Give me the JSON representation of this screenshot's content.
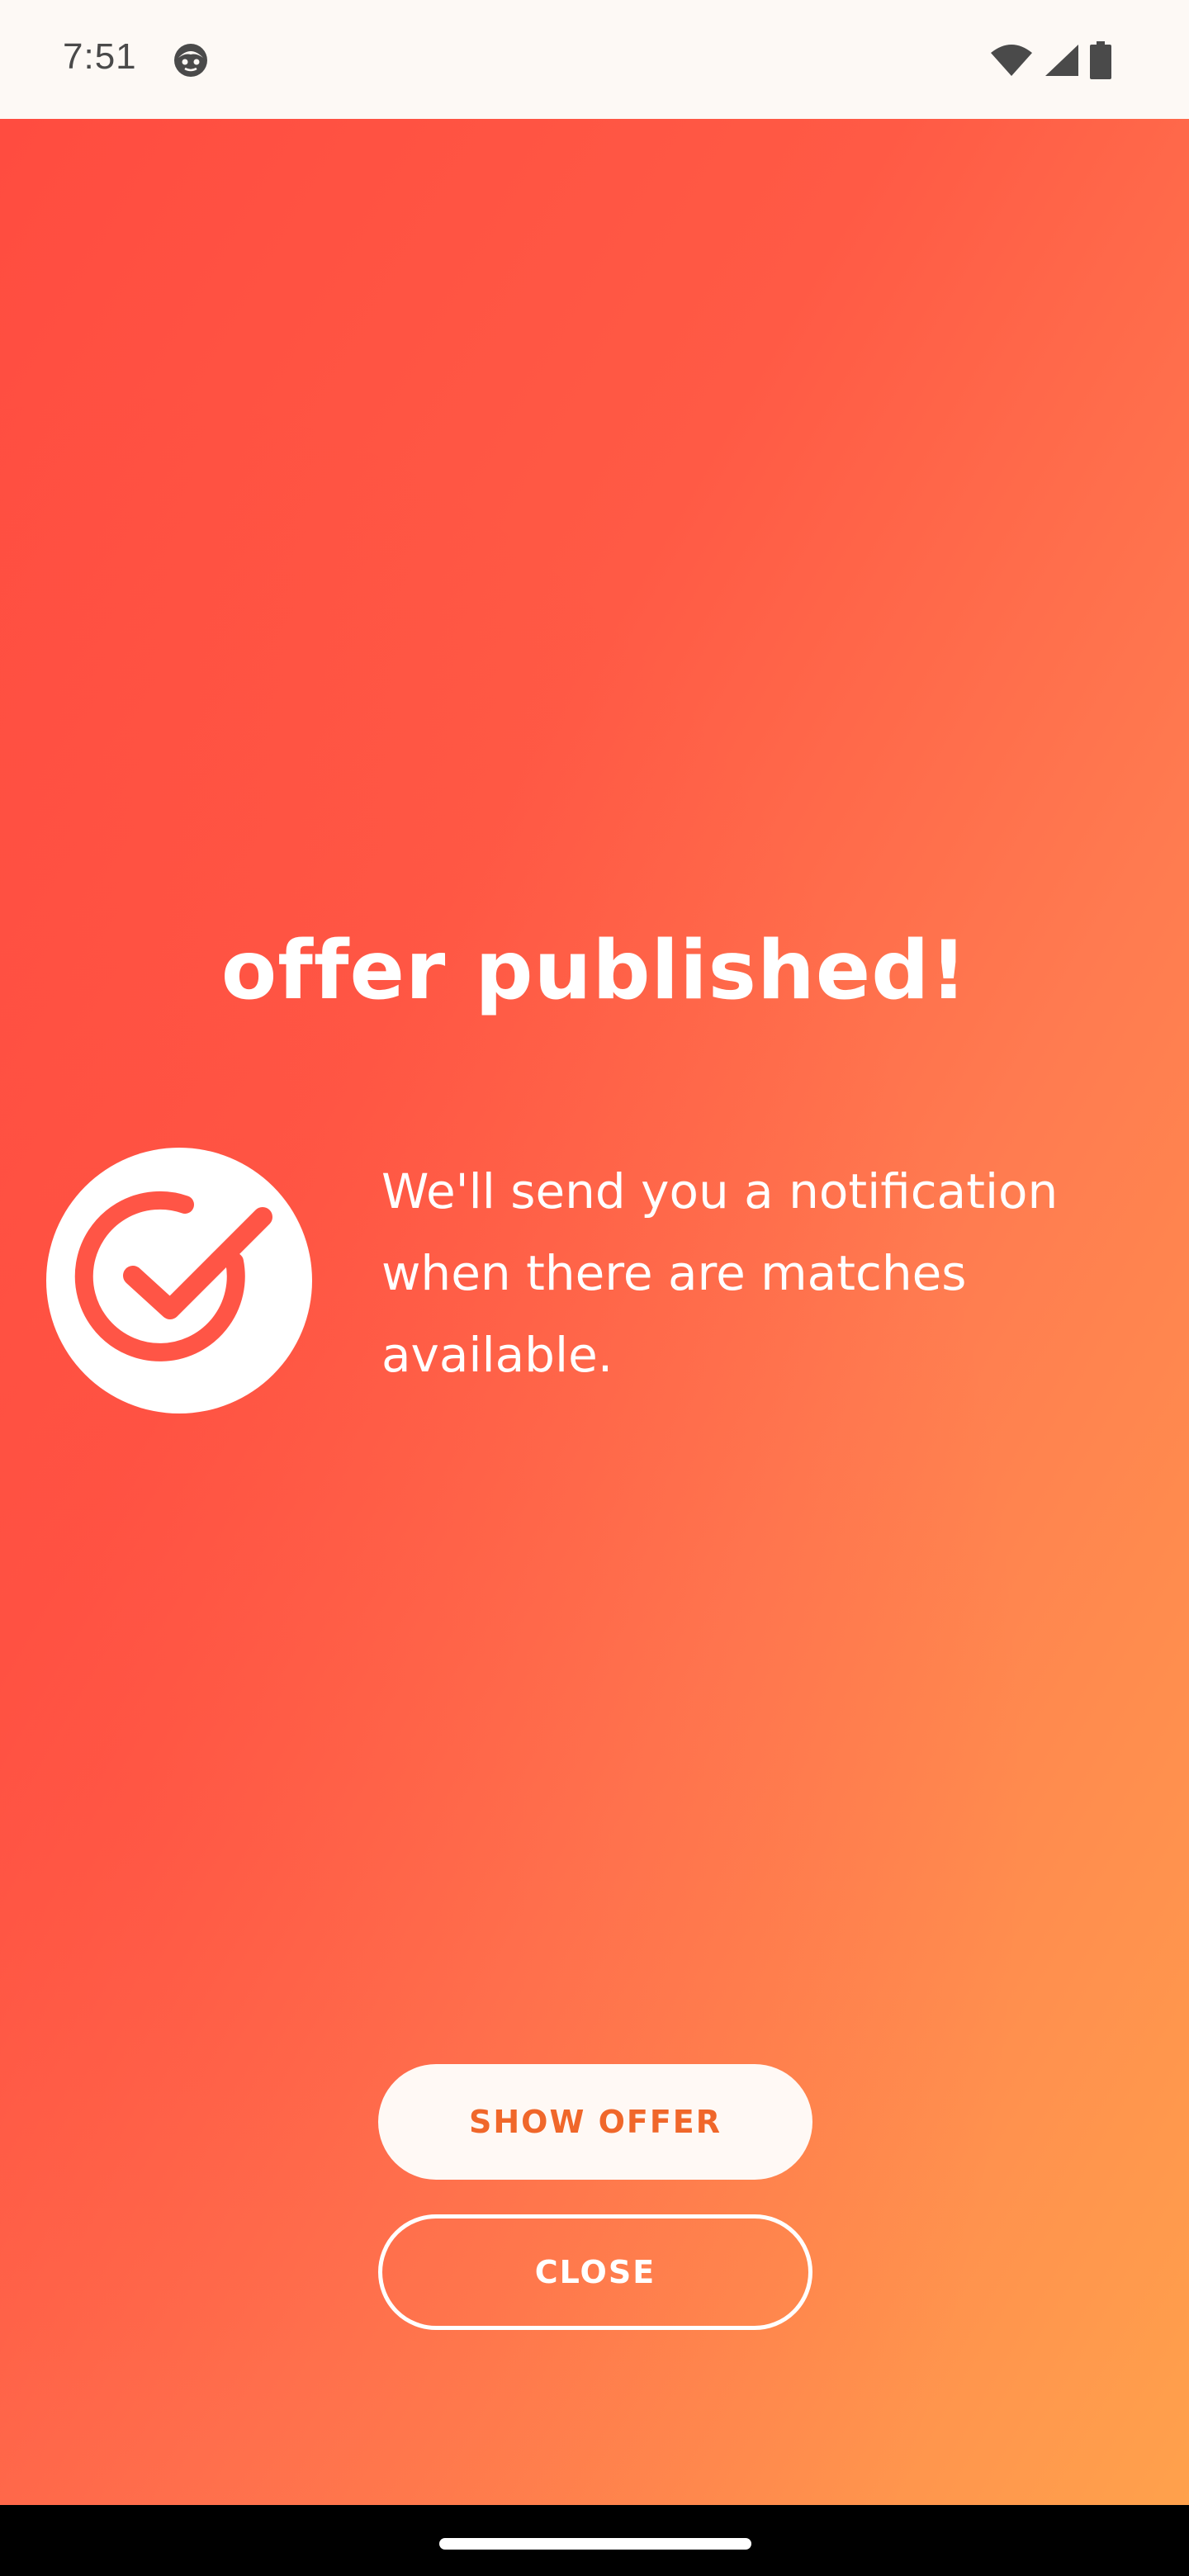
{
  "status_bar": {
    "time": "7:51",
    "icons": [
      "face-icon",
      "wifi-icon",
      "signal-icon",
      "battery-icon"
    ]
  },
  "main": {
    "title": "offer published!",
    "badge_icon": "check-circle-icon",
    "message": "We'll send you a notification when there are matches available."
  },
  "actions": {
    "show_offer_label": "SHOW OFFER",
    "close_label": "CLOSE"
  },
  "colors": {
    "gradient_start": "#ff4c40",
    "gradient_end": "#ffa14c",
    "accent": "#f0672a",
    "text_on_accent": "#ffffff"
  }
}
